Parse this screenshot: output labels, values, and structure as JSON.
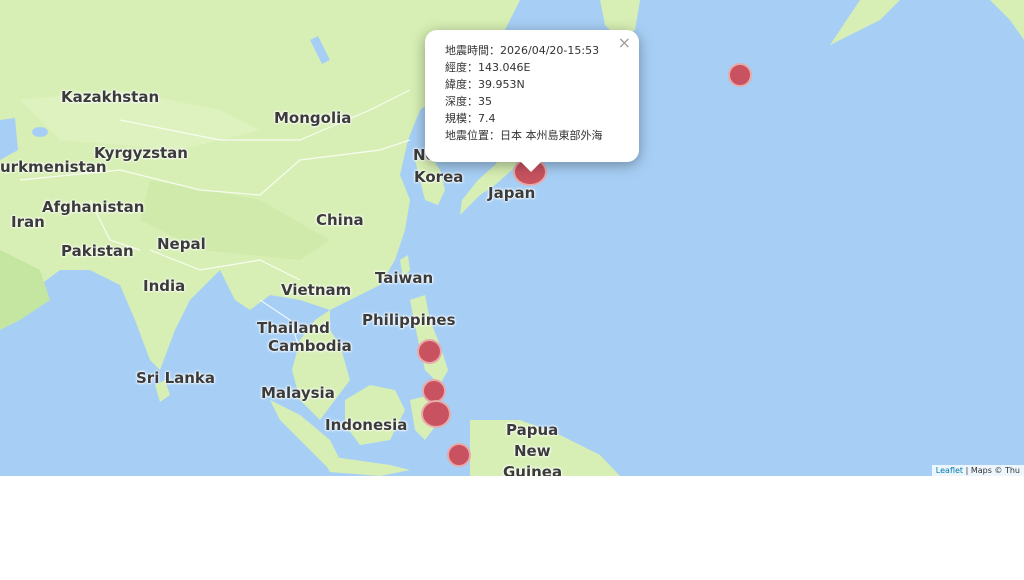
{
  "map": {
    "labels": {
      "kazakhstan": "Kazakhstan",
      "mongolia": "Mongolia",
      "kyrgyzstan": "Kyrgyzstan",
      "turkmenistan": "urkmenistan",
      "afghanistan": "Afghanistan",
      "iran": "Iran",
      "pakistan": "Pakistan",
      "nepal": "Nepal",
      "china": "China",
      "india": "India",
      "north_korea": "No",
      "korea": "Korea",
      "japan": "Japan",
      "taiwan": "Taiwan",
      "vietnam": "Vietnam",
      "philippines": "Philippines",
      "thailand": "Thailand",
      "cambodia": "Cambodia",
      "sri_lanka": "Sri Lanka",
      "malaysia": "Malaysia",
      "indonesia": "Indonesia",
      "papua": "Papua",
      "new": "New",
      "guinea": "Guinea"
    },
    "colors": {
      "water": "#a7cff5",
      "land": "#d9f0b8",
      "land_dark": "#c5e6a0",
      "marker_fill": "#c8525f",
      "marker_stroke": "#e9a9a9"
    },
    "attribution": {
      "leaflet": "Leaflet",
      "rest": " | Maps © Thu"
    }
  },
  "popup": {
    "close": "×",
    "rows": {
      "time": "地震時間：2026/04/20-15:53",
      "longitude": "經度：143.046E",
      "latitude": "緯度：39.953N",
      "depth": "深度：35",
      "magnitude": "規模：7.4",
      "location": "地震位置：日本 本州島東部外海"
    }
  }
}
